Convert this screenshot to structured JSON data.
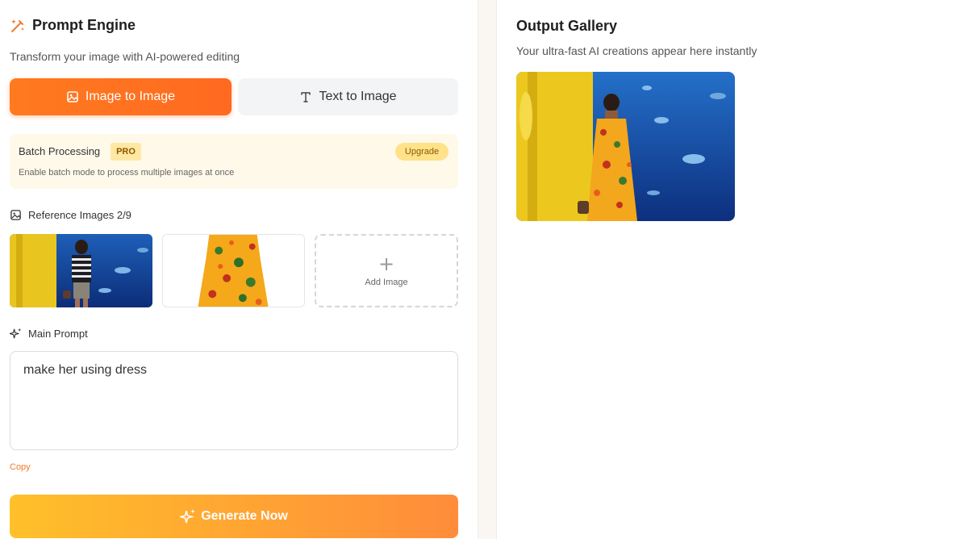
{
  "header": {
    "title": "Prompt Engine",
    "icon": "magic-wand-icon",
    "subtitle": "Transform your image with AI-powered editing"
  },
  "modes": {
    "image_to_image": "Image to Image",
    "text_to_image": "Text to Image",
    "active": "image_to_image"
  },
  "batch": {
    "title": "Batch Processing",
    "badge": "PRO",
    "upgrade_label": "Upgrade",
    "description": "Enable batch mode to process multiple images at once"
  },
  "reference": {
    "label": "Reference Images 2/9",
    "add_label": "Add Image"
  },
  "prompt": {
    "label": "Main Prompt",
    "value": "make her using dress",
    "copy_label": "Copy"
  },
  "generate": {
    "label": "Generate Now"
  },
  "gallery": {
    "title": "Output Gallery",
    "subtitle": "Your ultra-fast AI creations appear here instantly"
  },
  "colors": {
    "accent": "#ff7a1f",
    "generate_start": "#ffc02a",
    "generate_end": "#ff8c3a",
    "batch_bg": "#fff9ea",
    "pro_badge": "#ffe8a3"
  }
}
